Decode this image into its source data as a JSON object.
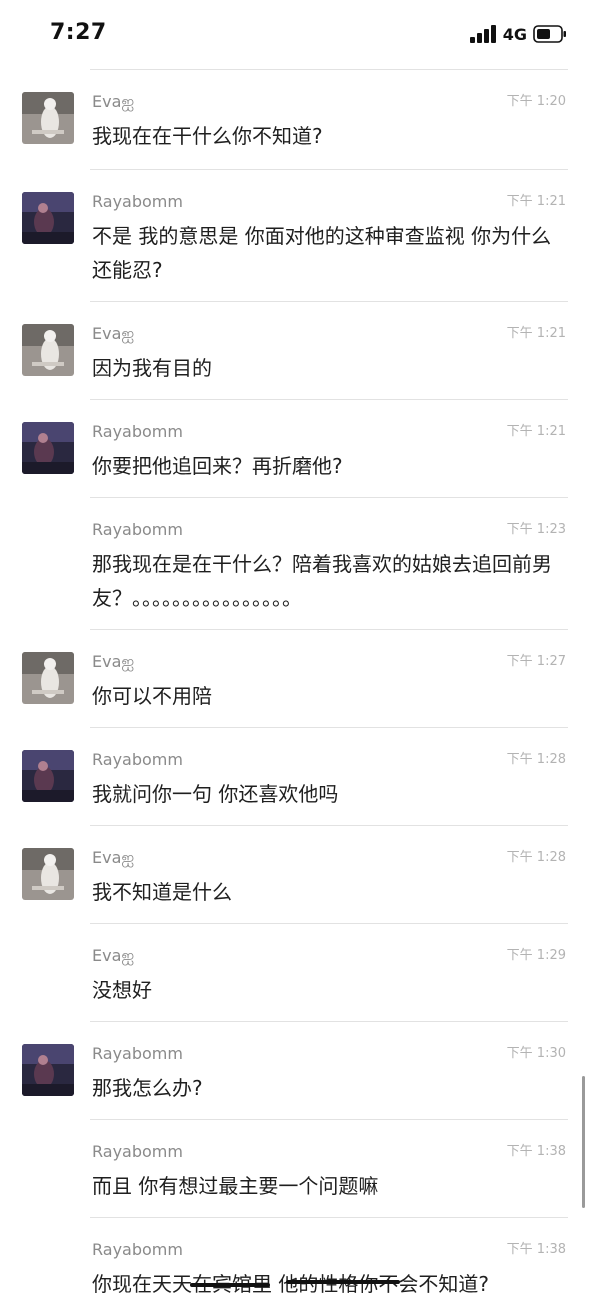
{
  "status": {
    "time": "7:27",
    "network": "4G",
    "icons": [
      "signal-icon",
      "battery-icon"
    ]
  },
  "messages": [
    {
      "sender": "Evaஐ",
      "time": "下午 1:20",
      "text": "我现在在干什么你不知道?",
      "avatar": "eva"
    },
    {
      "sender": "Rayabomm",
      "time": "下午 1:21",
      "text": "不是 我的意思是 你面对他的这种审查监视 你为什么 还能忍?",
      "avatar": "raya"
    },
    {
      "sender": "Evaஐ",
      "time": "下午 1:21",
      "text": "因为我有目的",
      "avatar": "eva"
    },
    {
      "sender": "Rayabomm",
      "time": "下午 1:21",
      "text": "你要把他追回来？再折磨他?",
      "avatar": "raya"
    },
    {
      "sender": "Rayabomm",
      "time": "下午 1:23",
      "text": "那我现在是在干什么？陪着我喜欢的姑娘去追回前男友？。。。。。。。。。。。。。。。。",
      "avatar": ""
    },
    {
      "sender": "Evaஐ",
      "time": "下午 1:27",
      "text": "你可以不用陪",
      "avatar": "eva"
    },
    {
      "sender": "Rayabomm",
      "time": "下午 1:28",
      "text": "我就问你一句 你还喜欢他吗",
      "avatar": "raya"
    },
    {
      "sender": "Evaஐ",
      "time": "下午 1:28",
      "text": "我不知道是什么",
      "avatar": "eva"
    },
    {
      "sender": "Evaஐ",
      "time": "下午 1:29",
      "text": "没想好",
      "avatar": ""
    },
    {
      "sender": "Rayabomm",
      "time": "下午 1:30",
      "text": "那我怎么办?",
      "avatar": "raya"
    },
    {
      "sender": "Rayabomm",
      "time": "下午 1:38",
      "text": "而且 你有想过最主要一个问题嘛",
      "avatar": ""
    },
    {
      "sender": "Rayabomm",
      "time": "下午 1:38",
      "text": "你现在天天在宾馆里 他的性格你不会不知道?",
      "avatar": ""
    }
  ]
}
